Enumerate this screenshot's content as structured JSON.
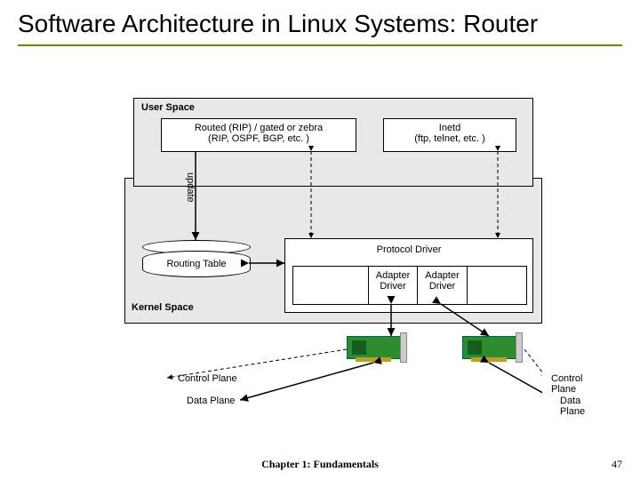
{
  "title": "Software Architecture in Linux Systems: Router",
  "user_space_label": "User Space",
  "kernel_space_label": "Kernel Space",
  "routed": {
    "line1": "Routed (RIP) / gated or zebra",
    "line2": "(RIP, OSPF, BGP, etc. )"
  },
  "inetd": {
    "line1": "Inetd",
    "line2": "(ftp, telnet, etc. )"
  },
  "update_label": "update",
  "routing_table_label": "Routing Table",
  "protocol_driver_label": "Protocol Driver",
  "adapter1": {
    "line1": "Adapter",
    "line2": "Driver"
  },
  "adapter2": {
    "line1": "Adapter",
    "line2": "Driver"
  },
  "control_plane_label": "Control Plane",
  "data_plane_label": "Data Plane",
  "footer_center": "Chapter 1: Fundamentals",
  "footer_page": "47"
}
